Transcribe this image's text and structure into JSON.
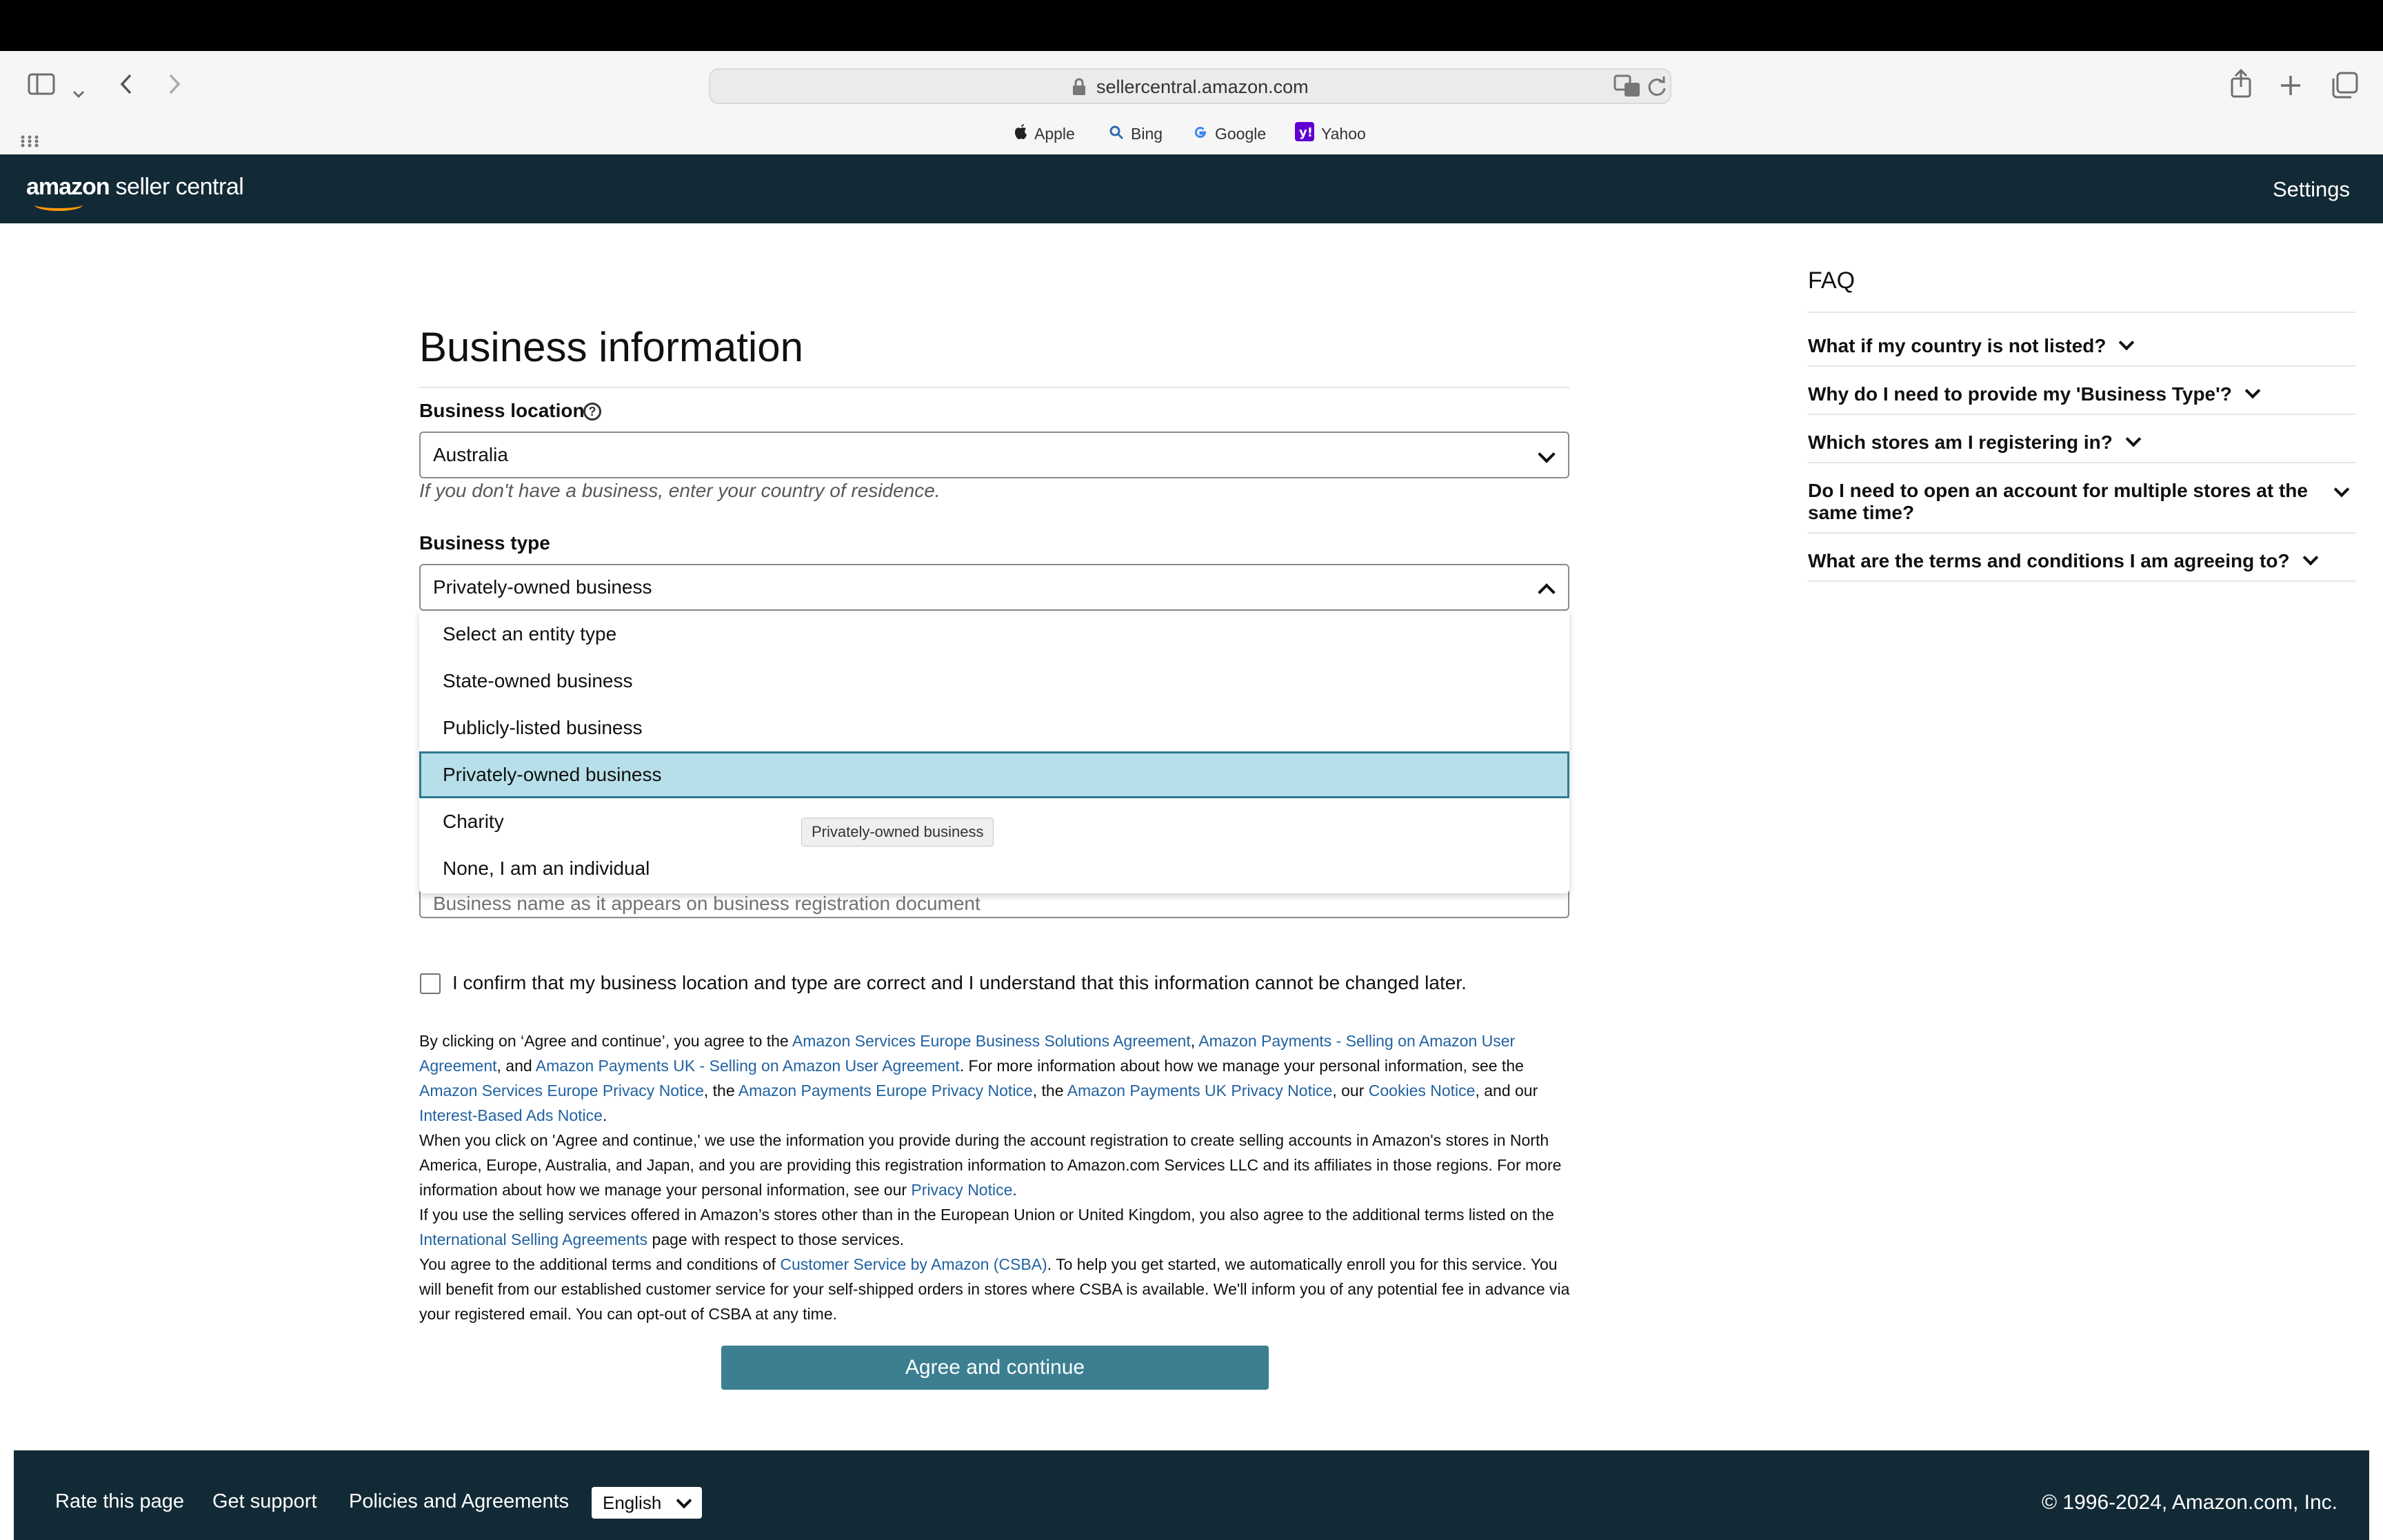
{
  "browser": {
    "url": "sellercentral.amazon.com",
    "bookmarks": [
      {
        "label": "Apple",
        "icon": "apple-icon"
      },
      {
        "label": "Bing",
        "icon": "search-icon"
      },
      {
        "label": "Google",
        "icon": "google-icon"
      },
      {
        "label": "Yahoo",
        "icon": "yahoo-icon"
      }
    ]
  },
  "header": {
    "logo_bold": "amazon",
    "logo_rest": " seller central",
    "settings": "Settings"
  },
  "form": {
    "title": "Business information",
    "location_label": "Business location",
    "location_value": "Australia",
    "location_hint": "If you don't have a business, enter your country of residence.",
    "type_label": "Business type",
    "type_value": "Privately-owned business",
    "type_options": [
      "Select an entity type",
      "State-owned business",
      "Publicly-listed business",
      "Privately-owned business",
      "Charity",
      "None, I am an individual"
    ],
    "tooltip": "Privately-owned business",
    "name_placeholder": "Business name as it appears on business registration document",
    "confirm_text": "I confirm that my business location and type are correct and I understand that this information cannot be changed later.",
    "agree_button": "Agree and continue"
  },
  "legal": {
    "p1": {
      "t1": "By clicking on ‘Agree and continue’, you agree to the ",
      "l1": "Amazon Services Europe Business Solutions Agreement",
      "t2": ", ",
      "l2": "Amazon Payments - Selling on Amazon User Agreement",
      "t3": ", and ",
      "l3": "Amazon Payments UK - Selling on Amazon User Agreement",
      "t4": ". For more information about how we manage your personal information, see the ",
      "l4": "Amazon Services Europe Privacy Notice",
      "t5": ", the ",
      "l5": "Amazon Payments Europe Privacy Notice",
      "t6": ", the ",
      "l6": "Amazon Payments UK Privacy Notice",
      "t7": ", our ",
      "l7": "Cookies Notice",
      "t8": ", and our ",
      "l8": "Interest-Based Ads Notice",
      "t9": "."
    },
    "p2": {
      "t1": "When you click on 'Agree and continue,' we use the information you provide during the account registration to create selling accounts in Amazon's stores in North America, Europe, Australia, and Japan, and you are providing this registration information to Amazon.com Services LLC and its affiliates in those regions. For more information about how we manage your personal information, see our ",
      "l1": "Privacy Notice",
      "t2": "."
    },
    "p3": {
      "t1": "If you use the selling services offered in Amazon’s stores other than in the European Union or United Kingdom, you also agree to the additional terms listed on the ",
      "l1": "International Selling Agreements",
      "t2": " page with respect to those services."
    },
    "p4": {
      "t1": "You agree to the additional terms and conditions of ",
      "l1": "Customer Service by Amazon (CSBA)",
      "t2": ". To help you get started, we automatically enroll you for this service. You will benefit from our established customer service for your self-shipped orders in stores where CSBA is available. We'll inform you of any potential fee in advance via your registered email. You can opt-out of CSBA at any time."
    }
  },
  "faq": {
    "title": "FAQ",
    "items": [
      "What if my country is not listed?",
      "Why do I need to provide my 'Business Type'?",
      "Which stores am I registering in?",
      "Do I need to open an account for multiple stores at the same time?",
      "What are the terms and conditions I am agreeing to?"
    ]
  },
  "footer": {
    "rate": "Rate this page",
    "support": "Get support",
    "policies": "Policies and Agreements",
    "language": "English",
    "copyright": "© 1996-2024, Amazon.com, Inc."
  },
  "colors": {
    "header_bg": "#122a35",
    "button_bg": "#3b7f91",
    "link": "#2162a1",
    "selected_option_bg": "#b7dfe9"
  }
}
